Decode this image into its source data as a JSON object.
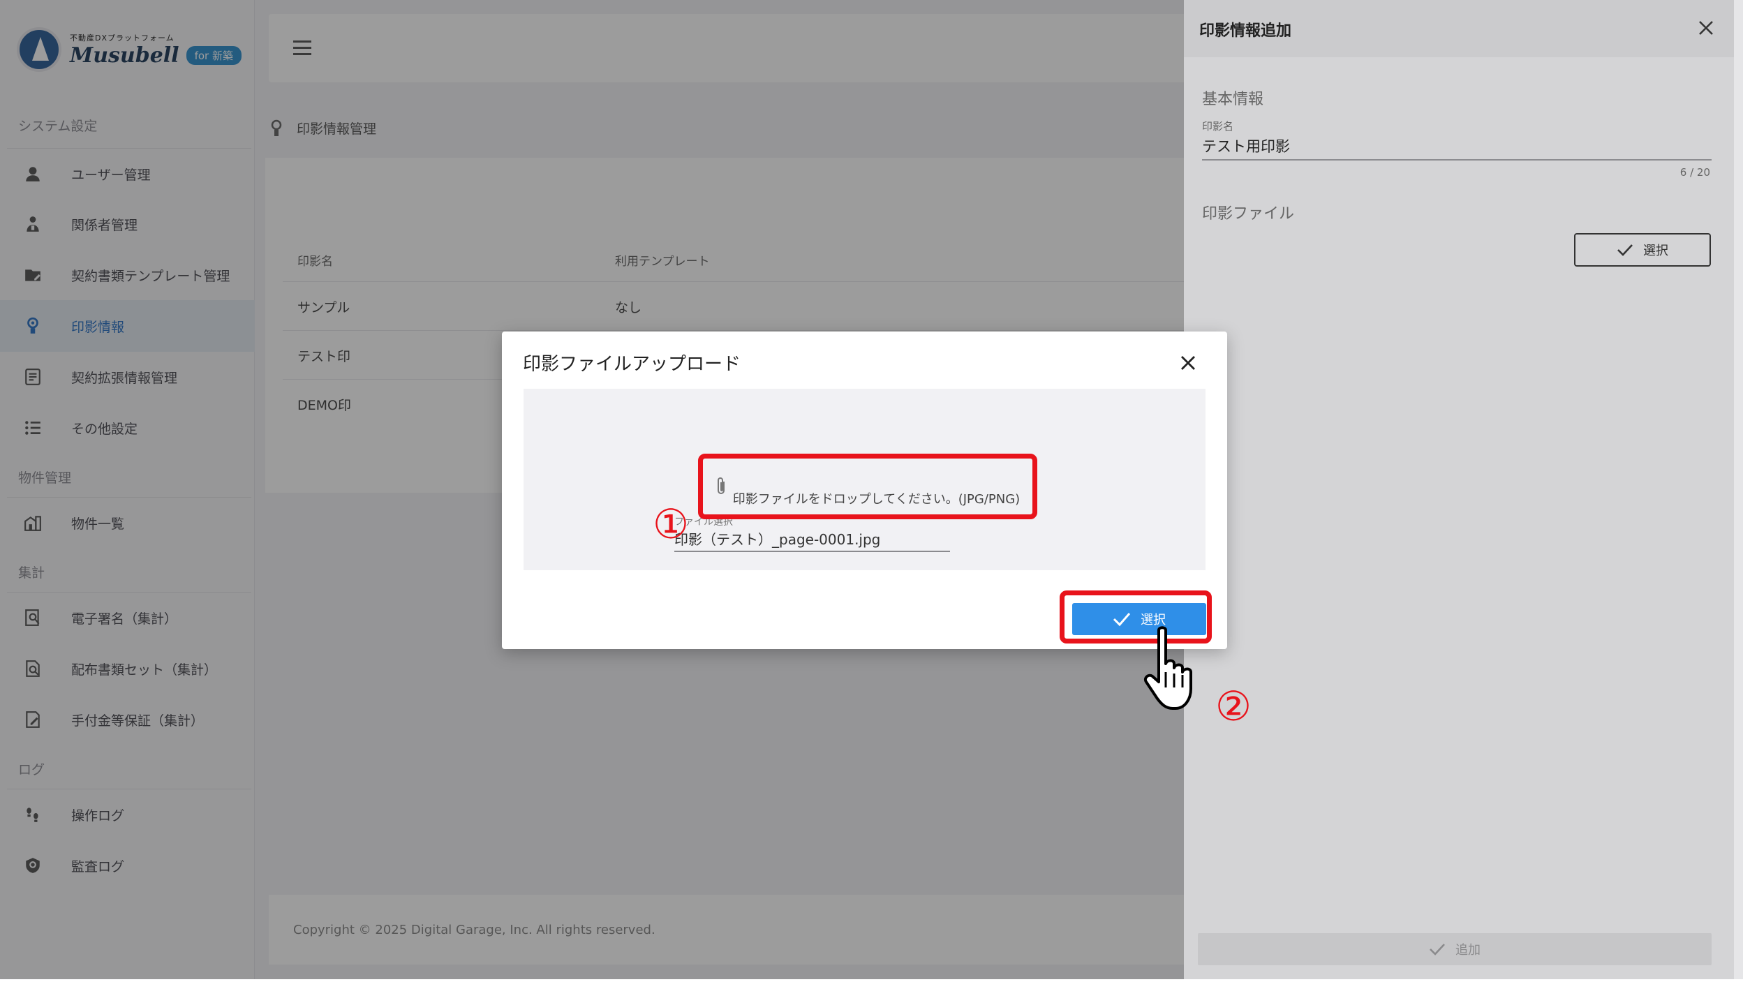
{
  "brand": {
    "tagline": "不動産DXプラットフォーム",
    "name": "Musubell",
    "badge": "for 新築"
  },
  "sidebar": {
    "sections": [
      {
        "label": "システム設定",
        "items": [
          {
            "label": "ユーザー管理",
            "icon": "user-icon"
          },
          {
            "label": "関係者管理",
            "icon": "people-icon"
          },
          {
            "label": "契約書類テンプレート管理",
            "icon": "folder-edit-icon"
          },
          {
            "label": "印影情報",
            "icon": "seal-icon",
            "active": true
          },
          {
            "label": "契約拡張情報管理",
            "icon": "document-list-icon"
          },
          {
            "label": "その他設定",
            "icon": "list-icon"
          }
        ]
      },
      {
        "label": "物件管理",
        "items": [
          {
            "label": "物件一覧",
            "icon": "building-icon"
          }
        ]
      },
      {
        "label": "集計",
        "items": [
          {
            "label": "電子署名（集計）",
            "icon": "doc-search-icon"
          },
          {
            "label": "配布書類セット（集計）",
            "icon": "doc-magnify-icon"
          },
          {
            "label": "手付金等保証（集計）",
            "icon": "doc-pen-icon"
          }
        ]
      },
      {
        "label": "ログ",
        "items": [
          {
            "label": "操作ログ",
            "icon": "footprint-icon"
          },
          {
            "label": "監査ログ",
            "icon": "shield-search-icon"
          }
        ]
      }
    ]
  },
  "breadcrumb": {
    "label": "印影情報管理"
  },
  "table": {
    "headers": [
      "印影名",
      "利用テンプレート"
    ],
    "rows": [
      [
        "サンプル",
        "なし"
      ],
      [
        "テスト印",
        ""
      ],
      [
        "DEMO印",
        ""
      ]
    ]
  },
  "footer": {
    "copyright": "Copyright © 2025 Digital Garage, Inc. All rights reserved."
  },
  "drawer": {
    "title": "印影情報追加",
    "basic_section": "基本情報",
    "seal_name_label": "印影名",
    "seal_name_value": "テスト用印影",
    "seal_name_counter": "6 / 20",
    "file_section": "印影ファイル",
    "select_label": "選択",
    "add_label": "追加"
  },
  "modal": {
    "title": "印影ファイルアップロード",
    "drop_hint": "印影ファイルをドロップしてください。(JPG/PNG)",
    "file_label": "ファイル選択",
    "file_value": "印影（テスト）_page-0001.jpg",
    "select_label": "選択"
  },
  "annotations": {
    "step1": "①",
    "step2": "②",
    "color": "#e8131b"
  },
  "colors": {
    "accent": "#2f8fe8",
    "active_nav": "#2c73c4"
  }
}
